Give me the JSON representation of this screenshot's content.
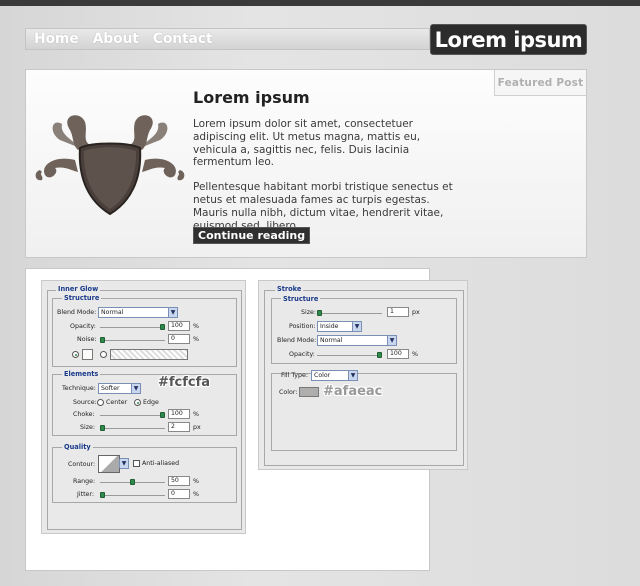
{
  "nav": {
    "home": "Home",
    "about": "About",
    "contact": "Contact"
  },
  "logo": "Lorem ipsum",
  "featured": {
    "tab": "Featured Post",
    "title": "Lorem ipsum",
    "para1": "Lorem ipsum dolor sit amet, consectetuer adipiscing elit. Ut metus magna, mattis eu, vehicula a, sagittis nec, felis. Duis lacinia fermentum leo.",
    "para2": "Pellentesque habitant morbi tristique senectus et netus et malesuada fames ac turpis egestas. Mauris nulla nibh, dictum vitae, hendrerit vitae, euismod sed, libero.",
    "button": "Continue reading"
  },
  "inner_glow": {
    "title": "Inner Glow",
    "structure": "Structure",
    "blend_mode_label": "Blend Mode:",
    "blend_mode": "Normal",
    "opacity_label": "Opacity:",
    "opacity": "100",
    "noise_label": "Noise:",
    "noise": "0",
    "percent": "%",
    "elements": "Elements",
    "technique_label": "Technique:",
    "technique": "Softer",
    "source_label": "Source:",
    "source_center": "Center",
    "source_edge": "Edge",
    "choke_label": "Choke:",
    "choke": "100",
    "size_label": "Size:",
    "size": "2",
    "px": "px",
    "quality": "Quality",
    "contour_label": "Contour:",
    "anti_aliased": "Anti-aliased",
    "range_label": "Range:",
    "range": "50",
    "jitter_label": "Jitter:",
    "jitter": "0",
    "color_note": "#fcfcfa"
  },
  "stroke": {
    "title": "Stroke",
    "structure": "Structure",
    "size_label": "Size:",
    "size": "1",
    "px": "px",
    "position_label": "Position:",
    "position": "Inside",
    "blend_mode_label": "Blend Mode:",
    "blend_mode": "Normal",
    "opacity_label": "Opacity:",
    "opacity": "100",
    "percent": "%",
    "fill_type_label": "Fill Type:",
    "fill_type": "Color",
    "color_label": "Color:",
    "color_note": "#afaeac"
  },
  "colors": {
    "stroke_color": "#afaeac",
    "glow_color": "#fcfcfa",
    "dark": "#2c2c2c"
  }
}
